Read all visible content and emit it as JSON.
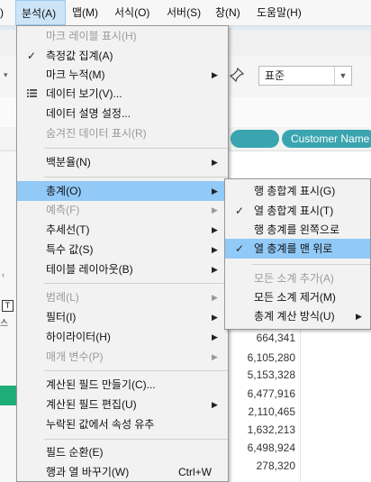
{
  "menubar": {
    "items": [
      {
        "label": "분석(A)",
        "active": true
      },
      {
        "label": "맵(M)"
      },
      {
        "label": "서식(O)"
      },
      {
        "label": "서버(S)"
      },
      {
        "label": "창(N)"
      },
      {
        "label": "도움말(H)"
      }
    ],
    "left_stub": ")"
  },
  "background": {
    "toolbar_select_value": "표준",
    "pill_label": "Customer Name",
    "left_char": "스",
    "numbers": [
      "664,341",
      "6,105,280",
      "5,153,328",
      "6,477,916",
      "2,110,465",
      "1,632,213",
      "6,498,924",
      "278,320"
    ]
  },
  "analysis_menu": {
    "items": [
      {
        "label": "마크 레이블 표시(H)",
        "disabled": true
      },
      {
        "label": "측정값 집계(A)",
        "checked": true
      },
      {
        "label": "마크 누적(M)",
        "submenu": true
      },
      {
        "label": "데이터 보기(V)...",
        "icon": "table-icon"
      },
      {
        "label": "데이터 설명 설정..."
      },
      {
        "label": "숨겨진 데이터 표시(R)",
        "disabled": true
      },
      {
        "label": "백분율(N)",
        "submenu": true
      },
      {
        "label": "총계(O)",
        "submenu": true,
        "highlighted": true
      },
      {
        "label": "예측(F)",
        "submenu": true,
        "disabled": true
      },
      {
        "label": "추세선(T)",
        "submenu": true
      },
      {
        "label": "특수 값(S)",
        "submenu": true
      },
      {
        "label": "테이블 레이아웃(B)",
        "submenu": true
      },
      {
        "label": "범례(L)",
        "submenu": true,
        "disabled": true
      },
      {
        "label": "필터(I)",
        "submenu": true
      },
      {
        "label": "하이라이터(H)",
        "submenu": true
      },
      {
        "label": "매개 변수(P)",
        "submenu": true,
        "disabled": true
      },
      {
        "label": "계산된 필드 만들기(C)..."
      },
      {
        "label": "계산된 필드 편집(U)",
        "submenu": true
      },
      {
        "label": "누락된 값에서 속성 유추"
      },
      {
        "label": "필드 순환(E)"
      },
      {
        "label": "행과 열 바꾸기(W)",
        "shortcut": "Ctrl+W"
      }
    ]
  },
  "totals_submenu": {
    "items": [
      {
        "label": "행 총합계 표시(G)"
      },
      {
        "label": "열 총합계 표시(T)",
        "checked": true
      },
      {
        "label": "행 총계를 왼쪽으로"
      },
      {
        "label": "열 총계를 맨 위로",
        "checked": true,
        "highlighted": true
      },
      {
        "label": "모든 소계 추가(A)",
        "disabled": true
      },
      {
        "label": "모든 소계 제거(M)"
      },
      {
        "label": "총계 계산 방식(U)",
        "submenu": true
      }
    ]
  }
}
